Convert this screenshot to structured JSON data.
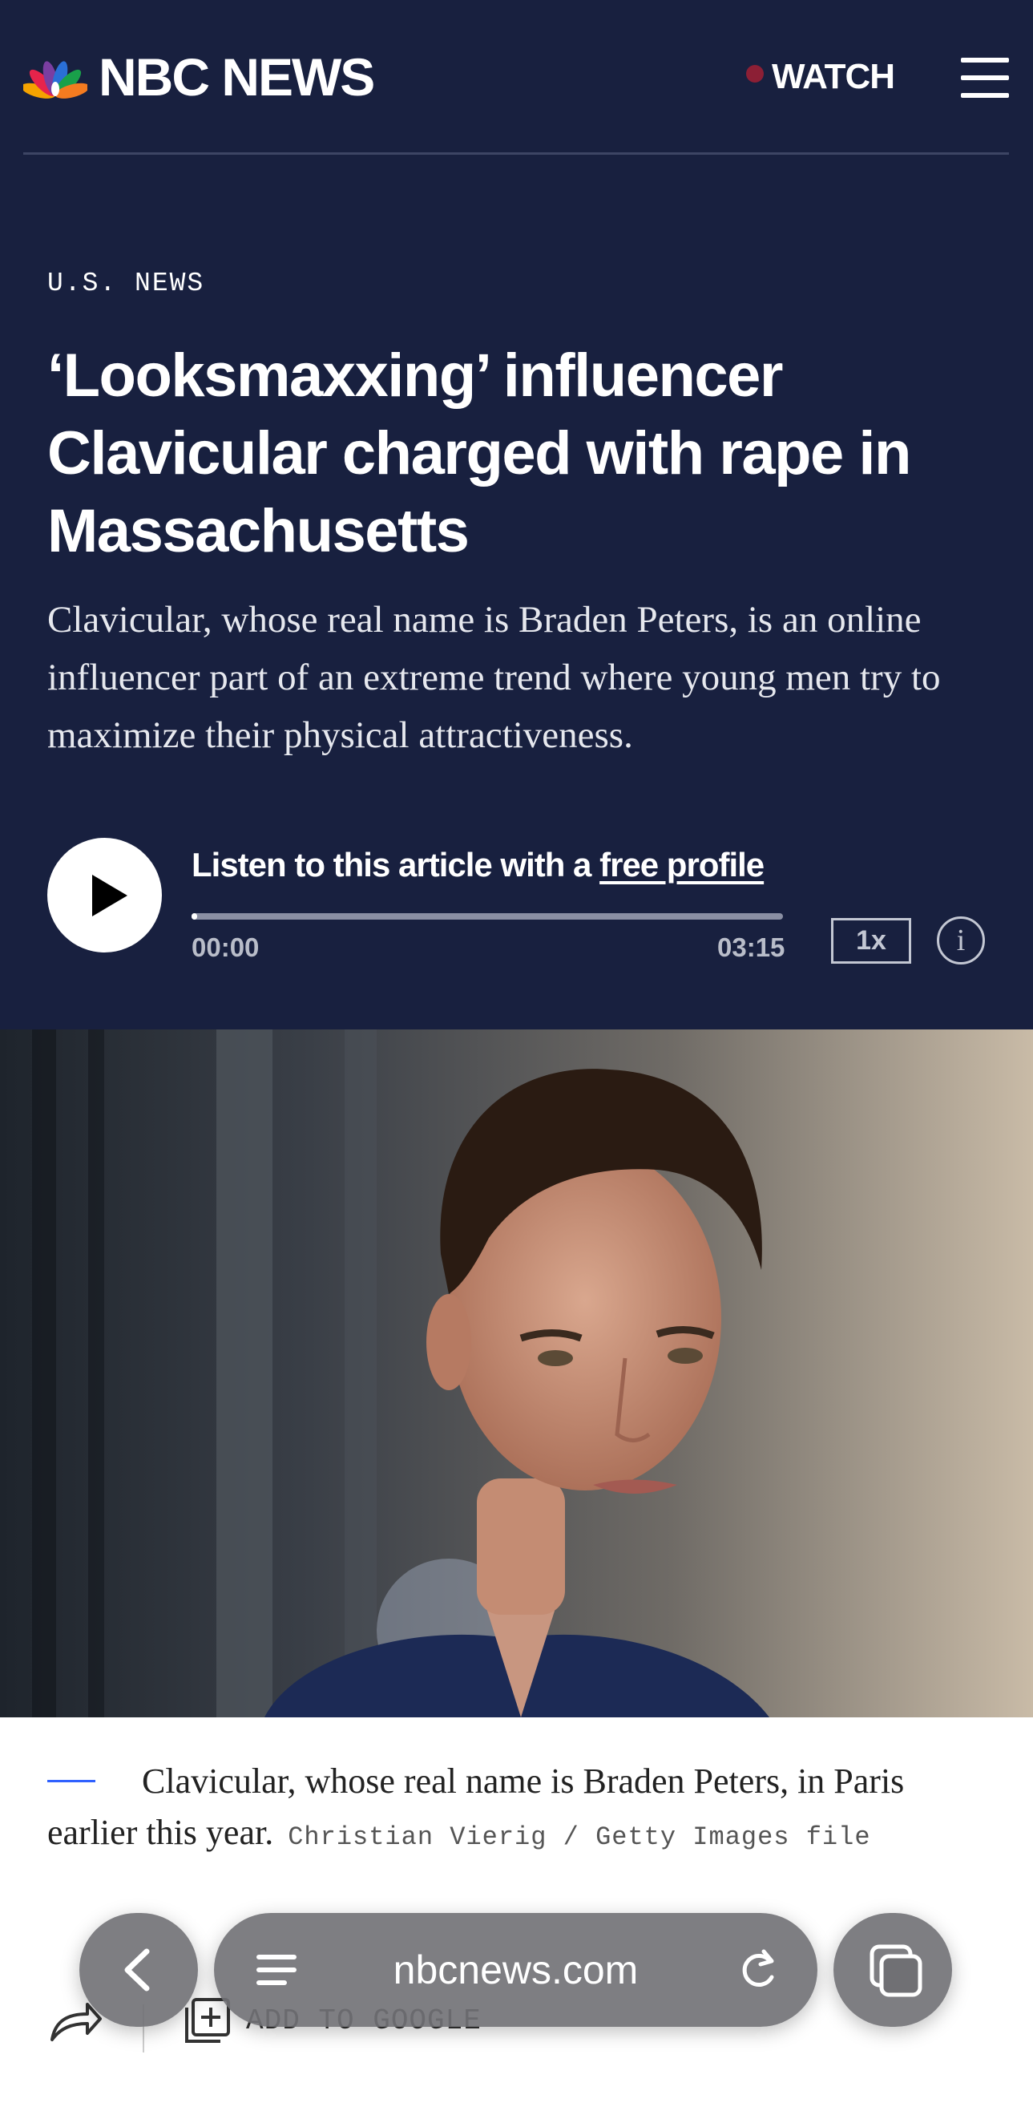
{
  "header": {
    "brand": "NBC NEWS",
    "watch_label": "WATCH"
  },
  "article": {
    "section": "U.S. NEWS",
    "headline_lines": [
      "‘Looksmaxxing’ influencer",
      "Clavicular charged with rape in",
      "Massachusetts"
    ],
    "dek": "Clavicular, whose real name is Braden Peters, is an online influencer part of an extreme trend where young men try to maximize their physical attractiveness."
  },
  "audio": {
    "prompt": "Listen to this article with a ",
    "link_label": "free profile",
    "current_time": "00:00",
    "duration": "03:15",
    "progress": 0.01,
    "speed": "1x",
    "info_label": "i"
  },
  "caption": {
    "text": "Clavicular, whose real name is Braden Peters, in Paris earlier this year.",
    "credit": "Christian Vierig / Getty Images file"
  },
  "actions": {
    "add_label": "ADD TO GOOGLE"
  },
  "browser": {
    "url": "nbcnews.com"
  },
  "colors": {
    "header_bg": "#18203f",
    "live_dot": "#8c1f35",
    "caption_rule": "#3061ff"
  },
  "icons": [
    "peacock-logo-icon",
    "menu-icon",
    "play-icon",
    "share-icon",
    "add-to-google-icon",
    "back-icon",
    "reader-icon",
    "reload-icon",
    "tabs-icon"
  ]
}
